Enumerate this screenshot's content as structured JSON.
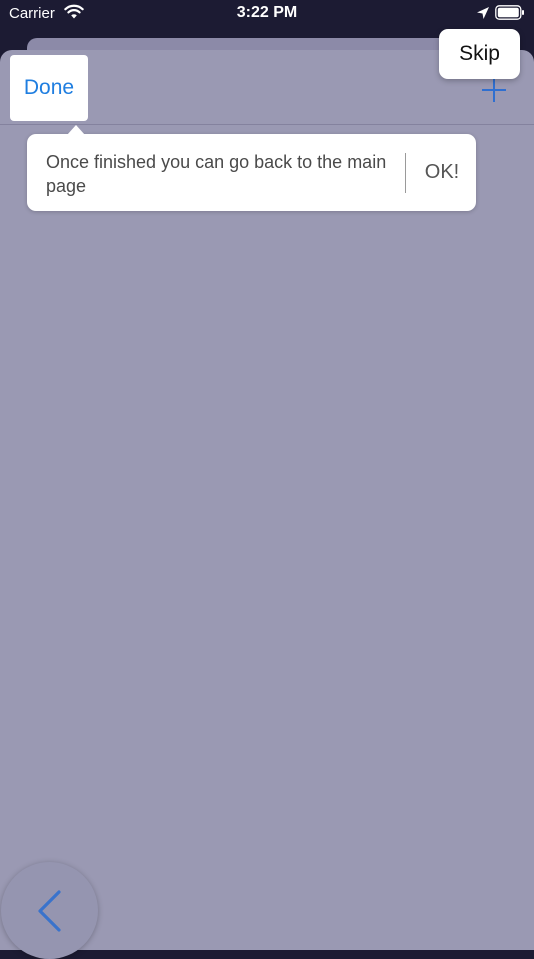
{
  "status_bar": {
    "carrier": "Carrier",
    "time": "3:22 PM"
  },
  "nav": {
    "done_label": "Done",
    "skip_label": "Skip"
  },
  "tooltip": {
    "message": "Once finished you can go back to the main page",
    "ok_label": "OK!"
  },
  "colors": {
    "accent": "#1f7ee0",
    "overlay": "#9a99b3",
    "status_bar_bg": "#1c1b33"
  },
  "icons": [
    "wifi-icon",
    "location-icon",
    "battery-icon",
    "add-icon",
    "back-chevron-icon"
  ]
}
